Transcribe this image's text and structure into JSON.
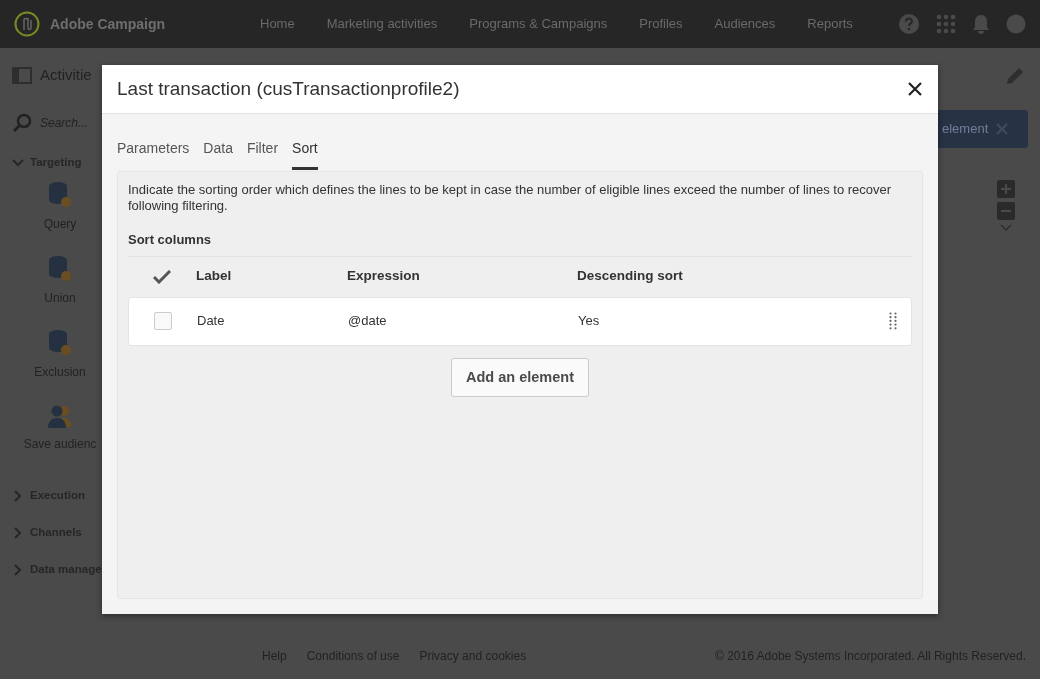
{
  "app_bar": {
    "brand": "Adobe Campaign",
    "nav": [
      {
        "label": "Home"
      },
      {
        "label": "Marketing activities"
      },
      {
        "label": "Programs & Campaigns"
      },
      {
        "label": "Profiles"
      },
      {
        "label": "Audiences"
      },
      {
        "label": "Reports"
      }
    ]
  },
  "sidebar": {
    "title": "Activitie",
    "search": {
      "placeholder": "Search..."
    },
    "groups": [
      {
        "label": "Targeting",
        "expanded": true,
        "items": [
          {
            "label": "Query",
            "kind": "database"
          },
          {
            "label": "Union",
            "kind": "database"
          },
          {
            "label": "Exclusion",
            "kind": "database"
          },
          {
            "label": "Save audienc",
            "kind": "audience"
          }
        ]
      },
      {
        "label": "Execution",
        "expanded": false
      },
      {
        "label": "Channels",
        "expanded": false
      },
      {
        "label": "Data manage",
        "expanded": false
      }
    ]
  },
  "canvas": {
    "button": "element"
  },
  "dialog": {
    "title": "Last transaction (cusTransactionprofile2)",
    "tabs": [
      {
        "label": "Parameters",
        "selected": false
      },
      {
        "label": "Data",
        "selected": false
      },
      {
        "label": "Filter",
        "selected": false
      },
      {
        "label": "Sort",
        "selected": true
      }
    ],
    "description": "Indicate the sorting order which defines the lines to be kept in case the number of eligible lines exceed the number of lines to recover following filtering.",
    "section": "Sort columns",
    "table": {
      "columns": [
        "Label",
        "Expression",
        "Descending sort"
      ],
      "rows": [
        {
          "checked": false,
          "cells": [
            "Date",
            "@date",
            "Yes"
          ]
        }
      ]
    },
    "add_button": "Add an element"
  },
  "footer": {
    "links": [
      "Help",
      "Conditions of use",
      "Privacy and cookies"
    ],
    "copyright": "© 2016 Adobe Systems Incorporated. All Rights Reserved."
  }
}
